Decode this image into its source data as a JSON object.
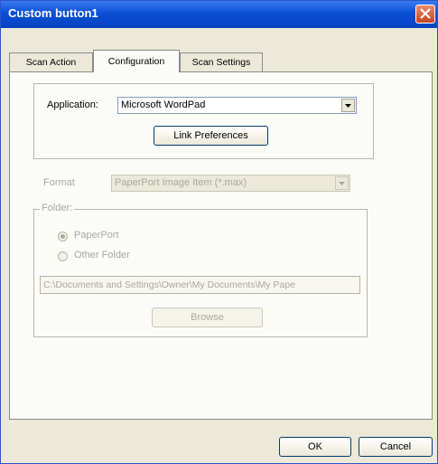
{
  "window": {
    "title": "Custom button1"
  },
  "tabs": [
    {
      "label": "Scan Action",
      "active": false
    },
    {
      "label": "Configuration",
      "active": true
    },
    {
      "label": "Scan Settings",
      "active": false
    }
  ],
  "application": {
    "label": "Application:",
    "value": "Microsoft WordPad",
    "link_button": "Link Preferences"
  },
  "format": {
    "label": "Format",
    "value": "PaperPort Image Item (*.max)"
  },
  "folder": {
    "group_label": "Folder:",
    "option_paperport": "PaperPort",
    "option_other": "Other Folder",
    "selected": "PaperPort",
    "path": "C:\\Documents and Settings\\Owner\\My Documents\\My Pape",
    "browse_button": "Browse"
  },
  "footer": {
    "ok_label": "OK",
    "cancel_label": "Cancel"
  },
  "icons": {
    "close": "close-icon",
    "dropdown": "chevron-down-icon"
  }
}
